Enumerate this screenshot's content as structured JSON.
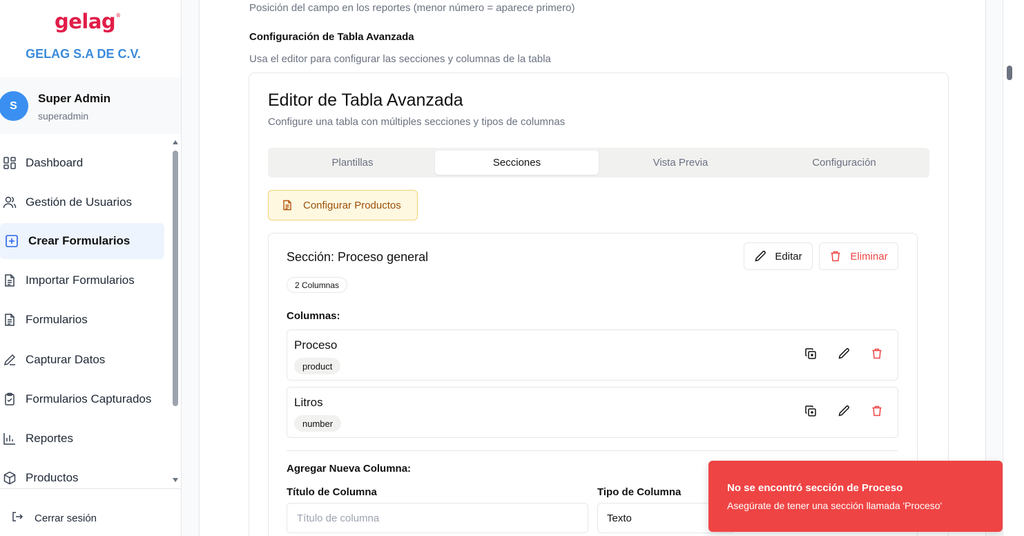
{
  "sidebar": {
    "logo": "gelag",
    "logo_mark": "®",
    "company": "GELAG S.A DE C.V.",
    "user": {
      "initial": "S",
      "name": "Super Admin",
      "username": "superadmin"
    },
    "items": [
      {
        "label": "Dashboard",
        "icon": "grid-icon"
      },
      {
        "label": "Gestión de Usuarios",
        "icon": "users-icon"
      },
      {
        "label": "Crear Formularios",
        "icon": "plus-square-icon",
        "active": true
      },
      {
        "label": "Importar Formularios",
        "icon": "file-icon"
      },
      {
        "label": "Formularios",
        "icon": "file-icon"
      },
      {
        "label": "Capturar Datos",
        "icon": "pen-icon"
      },
      {
        "label": "Formularios Capturados",
        "icon": "clipboard-check-icon"
      },
      {
        "label": "Reportes",
        "icon": "bar-chart-icon"
      },
      {
        "label": "Productos",
        "icon": "package-icon"
      }
    ],
    "logout": "Cerrar sesión"
  },
  "main": {
    "position_hint": "Posición del campo en los reportes (menor número = aparece primero)",
    "advanced_label": "Configuración de Tabla Avanzada",
    "advanced_hint": "Usa el editor para configurar las secciones y columnas de la tabla",
    "editor": {
      "title": "Editor de Tabla Avanzada",
      "subtitle": "Configure una tabla con múltiples secciones y tipos de columnas",
      "tabs": [
        {
          "label": "Plantillas"
        },
        {
          "label": "Secciones",
          "active": true
        },
        {
          "label": "Vista Previa"
        },
        {
          "label": "Configuración"
        }
      ],
      "configure_products": "Configurar Productos",
      "section": {
        "title": "Sección: Proceso general",
        "edit_label": "Editar",
        "delete_label": "Eliminar",
        "count_badge": "2 Columnas",
        "columns_label": "Columnas:",
        "columns": [
          {
            "name": "Proceso",
            "type": "product"
          },
          {
            "name": "Litros",
            "type": "number"
          }
        ],
        "add_column_label": "Agregar Nueva Columna:",
        "title_field_label": "Título de Columna",
        "title_field_placeholder": "Título de columna",
        "type_field_label": "Tipo de Columna",
        "type_field_value": "Texto"
      }
    }
  },
  "toast": {
    "title": "No se encontró sección de Proceso",
    "message": "Asegúrate de tener una sección llamada 'Proceso'"
  },
  "colors": {
    "brand": "#e11d48",
    "company": "#3b8bdc",
    "avatar": "#3b8ff0",
    "active_nav_bg": "#eef4fd",
    "danger": "#ef4444",
    "amber_bg": "#fff8e1",
    "amber_text": "#9a4f0a"
  }
}
